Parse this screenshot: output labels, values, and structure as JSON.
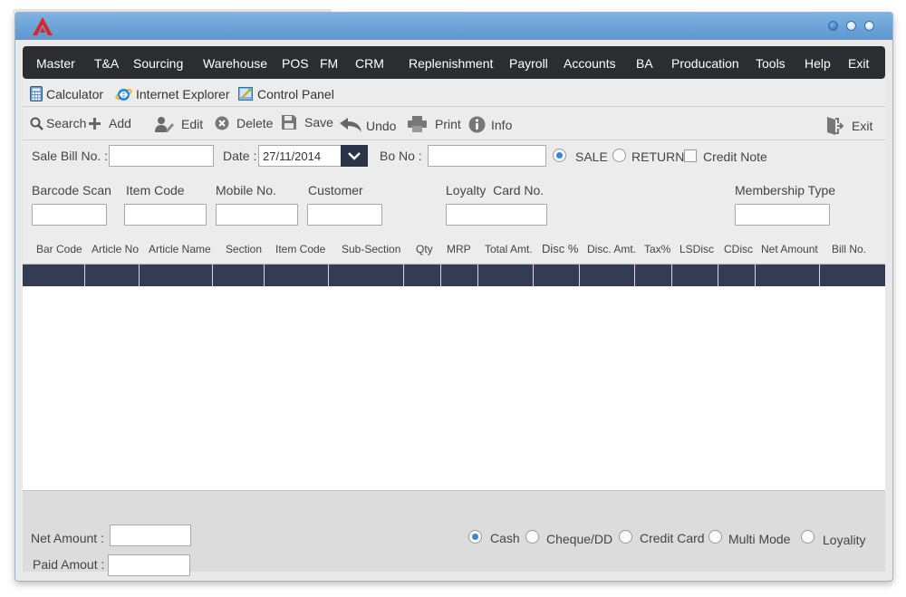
{
  "menu": [
    "Master",
    "T&A",
    "Sourcing",
    "Warehouse",
    "POS",
    "FM",
    "CRM",
    "Replenishment",
    "Payroll",
    "Accounts",
    "BA",
    "Producation",
    "Tools",
    "Help",
    "Exit"
  ],
  "quicklaunch": {
    "calculator": "Calculator",
    "internet_explorer": "Internet Explorer",
    "control_panel": "Control Panel"
  },
  "toolbar": {
    "search": "Search",
    "add": "Add",
    "edit": "Edit",
    "delete": "Delete",
    "save": "Save",
    "undo": "Undo",
    "print": "Print",
    "info": "Info",
    "exit": "Exit"
  },
  "form": {
    "sale_bill_label": "Sale Bill No. :",
    "sale_bill_value": "",
    "date_label": "Date :",
    "date_value": "27/11/2014",
    "bo_label": "Bo No :",
    "bo_value": "",
    "sale_label": "SALE",
    "sale_selected": true,
    "return_label": "RETURN",
    "return_selected": false,
    "credit_note_label": "Credit Note",
    "credit_note_checked": false,
    "barcode_label": "Barcode Scan",
    "item_code_label": "Item Code",
    "mobile_label": "Mobile No.",
    "customer_label": "Customer",
    "loyalty_label": "Loyalty  Card No.",
    "membership_label": "Membership Type"
  },
  "grid": {
    "columns": [
      "Bar Code",
      "Article No",
      "Article Name",
      "Section",
      "Item Code",
      "Sub-Section",
      "Qty",
      "MRP",
      "Total Amt.",
      "Disc %",
      "Disc. Amt.",
      "Tax%",
      "LSDisc",
      "CDisc",
      "Net Amount",
      "Bill No."
    ],
    "rows": []
  },
  "footer": {
    "net_amount_label": "Net Amount :",
    "net_amount_value": "",
    "paid_amount_label": "Paid Amout :",
    "paid_amount_value": "",
    "payment_modes": [
      "Cash",
      "Cheque/DD",
      "Credit Card",
      "Multi Mode",
      "Loyality"
    ],
    "selected_mode": "Cash"
  },
  "colors": {
    "titlebar": "#6ea5d8",
    "menubar": "#2b2d30",
    "grid_header": "#333c54",
    "radio_selected": "#3a86d6",
    "logo": "#d9262c"
  },
  "icons": [
    "app-logo-icon",
    "calculator-icon",
    "internet-explorer-icon",
    "control-panel-icon",
    "search-icon",
    "add-icon",
    "edit-icon",
    "delete-icon",
    "save-icon",
    "undo-icon",
    "print-icon",
    "info-icon",
    "exit-icon",
    "chevron-down-icon"
  ]
}
